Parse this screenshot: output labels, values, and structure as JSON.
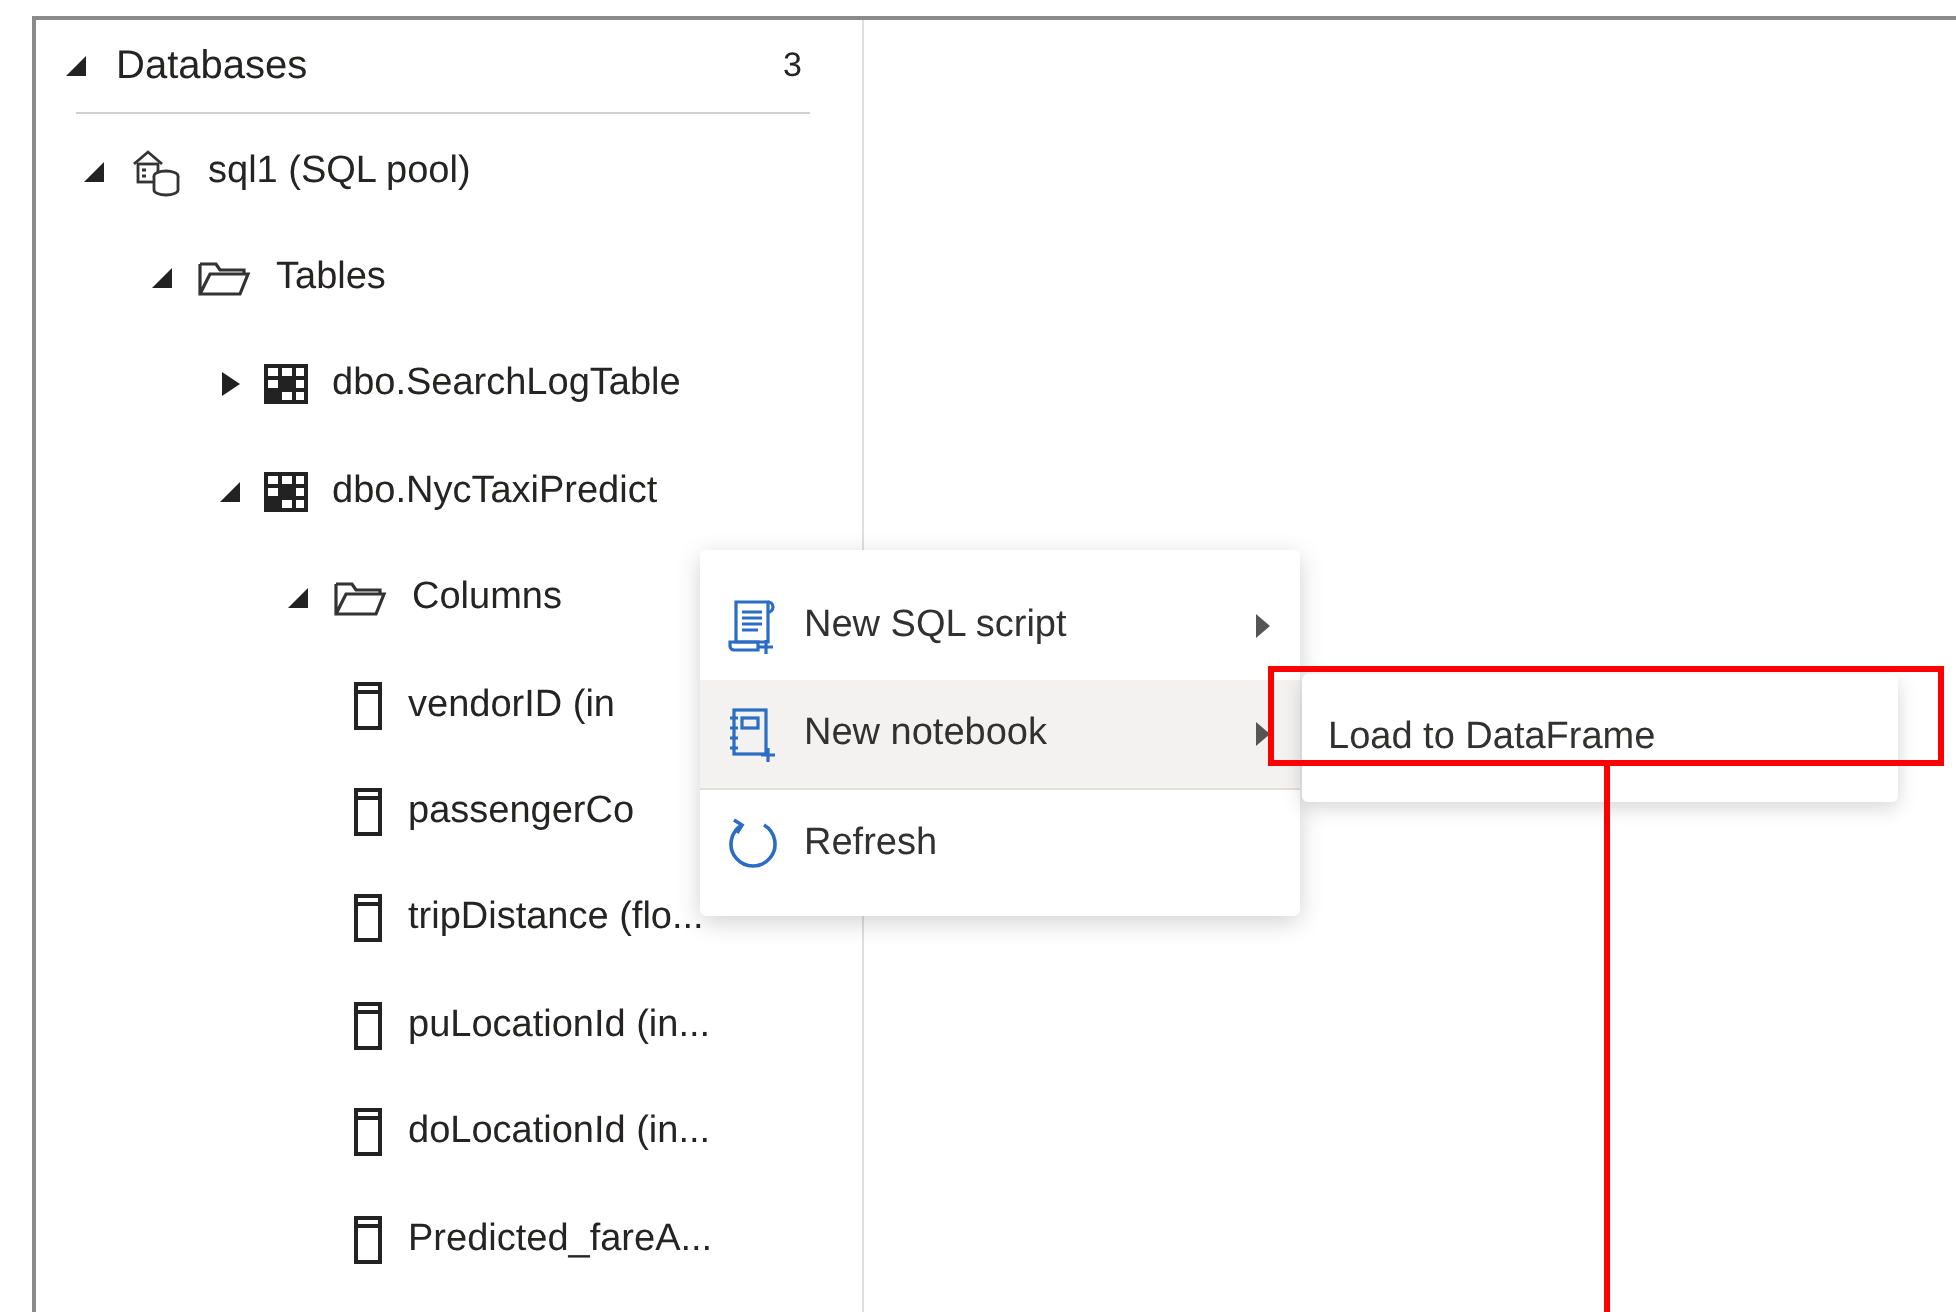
{
  "panel": {
    "title": "Databases",
    "count": "3",
    "expanded": true
  },
  "tree": [
    {
      "label": "sql1 (SQL pool)",
      "kind": "pool",
      "expanded": true,
      "children": [
        {
          "label": "Tables",
          "kind": "folder",
          "expanded": true,
          "children": [
            {
              "label": "dbo.SearchLogTable",
              "kind": "table",
              "expanded": false
            },
            {
              "label": "dbo.NycTaxiPredict",
              "kind": "table",
              "expanded": true,
              "children": [
                {
                  "label": "Columns",
                  "kind": "folder",
                  "expanded": true,
                  "children": [
                    {
                      "label": "vendorID (in",
                      "kind": "column"
                    },
                    {
                      "label": "passengerCo",
                      "kind": "column"
                    },
                    {
                      "label": "tripDistance (flo...",
                      "kind": "column"
                    },
                    {
                      "label": "puLocationId (in...",
                      "kind": "column"
                    },
                    {
                      "label": "doLocationId (in...",
                      "kind": "column"
                    },
                    {
                      "label": "Predicted_fareA...",
                      "kind": "column"
                    }
                  ]
                }
              ]
            }
          ]
        }
      ]
    }
  ],
  "context_menu": {
    "items": [
      {
        "label": "New SQL script",
        "kind": "script",
        "has_submenu": true,
        "selected": false,
        "divider_above": false
      },
      {
        "label": "New notebook",
        "kind": "notebook",
        "has_submenu": true,
        "selected": true,
        "divider_above": false
      },
      {
        "label": "Refresh",
        "kind": "refresh",
        "has_submenu": false,
        "selected": false,
        "divider_above": true
      }
    ]
  },
  "submenu": {
    "items": [
      {
        "label": "Load to DataFrame"
      }
    ]
  }
}
